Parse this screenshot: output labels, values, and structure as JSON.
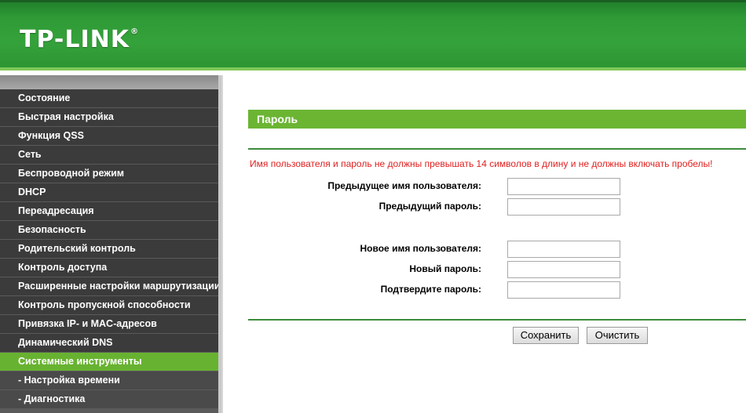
{
  "header": {
    "logo_text": "TP-LINK",
    "logo_mark": "®"
  },
  "sidebar": {
    "items": [
      {
        "label": "Состояние"
      },
      {
        "label": "Быстрая настройка"
      },
      {
        "label": "Функция QSS"
      },
      {
        "label": "Сеть"
      },
      {
        "label": "Беспроводной режим"
      },
      {
        "label": "DHCP"
      },
      {
        "label": "Переадресация"
      },
      {
        "label": "Безопасность"
      },
      {
        "label": "Родительский контроль"
      },
      {
        "label": "Контроль доступа"
      },
      {
        "label": "Расширенные настройки маршрутизации"
      },
      {
        "label": "Контроль пропускной способности"
      },
      {
        "label": "Привязка IP- и MAC-адресов"
      },
      {
        "label": "Динамический DNS"
      },
      {
        "label": "Системные инструменты",
        "active": true
      },
      {
        "label": "- Настройка времени"
      },
      {
        "label": "- Диагностика"
      }
    ]
  },
  "main": {
    "title": "Пароль",
    "warning": "Имя пользователя и пароль не должны превышать 14 символов в длину и не должны включать пробелы!",
    "fields": {
      "old_username": {
        "label": "Предыдущее имя пользователя:",
        "value": ""
      },
      "old_password": {
        "label": "Предыдущий пароль:",
        "value": ""
      },
      "new_username": {
        "label": "Новое имя пользователя:",
        "value": ""
      },
      "new_password": {
        "label": "Новый пароль:",
        "value": ""
      },
      "confirm_password": {
        "label": "Подтвердите пароль:",
        "value": ""
      }
    },
    "buttons": {
      "save": "Сохранить",
      "clear": "Очистить"
    }
  },
  "colors": {
    "header_green": "#34a23a",
    "menu_active": "#68b231",
    "menu_bg": "#3b3b3b",
    "title_bar": "#6bb533",
    "warning_red": "#e02020"
  }
}
